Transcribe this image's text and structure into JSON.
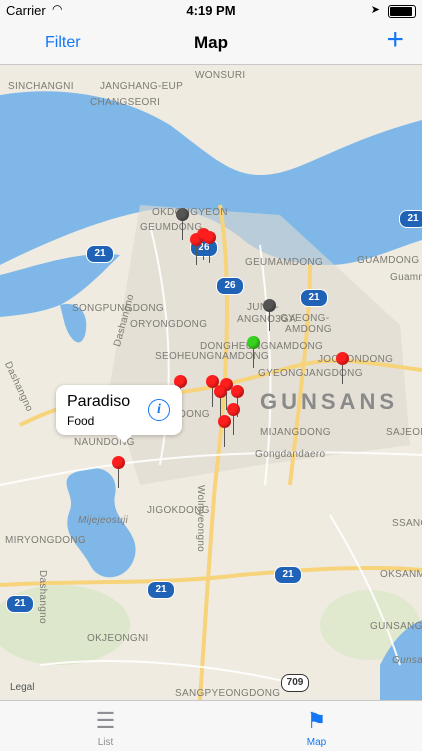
{
  "status_bar": {
    "carrier": "Carrier",
    "time": "4:19 PM"
  },
  "nav": {
    "left_button": "Filter",
    "title": "Map",
    "right_icon": "plus-icon"
  },
  "map": {
    "city_label": "GUNSANS",
    "area_labels": [
      "SINCHANGNI",
      "JANGHANG-EUP",
      "CHANGSEORI",
      "WONSURI",
      "OKDONGYEON",
      "GEUMDONG",
      "GEUMAMDONG",
      "GUAMDONG",
      "Guamnu",
      "SONGPUNGDONG",
      "ORYONGDONG",
      "JUNG-",
      "ANGNO3GA",
      "GYEONG-",
      "AMDONG",
      "DONGHEUNGNAMDONG",
      "SEOHEUNGNAMDONG",
      "JOCHONDONG",
      "GYEONGJANGDONG",
      "SONGDONG",
      "MIJANGDONG",
      "SAJEON",
      "NAUNDONG",
      "Gongdandaero",
      "Wolmyeongno",
      "Mijejeosuji",
      "JIGOKDONG",
      "SSANG",
      "MIRYONGDONG",
      "Dashangno",
      "Dashangno",
      "OKSANM",
      "OKJEONGNI",
      "GUNSANG",
      "SANGPYEONGDONG",
      "Gunsanje",
      "Dashangno"
    ],
    "route_shields": [
      "21",
      "26",
      "26",
      "21",
      "21",
      "21",
      "21",
      "21",
      "21",
      "709"
    ],
    "legal": "Legal",
    "pins": [
      {
        "color": "gray"
      },
      {
        "color": "red"
      },
      {
        "color": "red"
      },
      {
        "color": "red"
      },
      {
        "color": "gray"
      },
      {
        "color": "green"
      },
      {
        "color": "red"
      },
      {
        "color": "red"
      },
      {
        "color": "red"
      },
      {
        "color": "red"
      },
      {
        "color": "red"
      },
      {
        "color": "red"
      },
      {
        "color": "red"
      },
      {
        "color": "red"
      },
      {
        "color": "red"
      }
    ],
    "callout": {
      "name": "Paradiso",
      "category": "Food",
      "icon": "info-icon"
    }
  },
  "tabs": [
    {
      "label": "List",
      "icon": "list-icon",
      "selected": false
    },
    {
      "label": "Map",
      "icon": "map-icon",
      "selected": true
    }
  ],
  "colors": {
    "accent": "#1476f5",
    "pin_red": "#ff1e1e",
    "pin_gray": "#555555",
    "pin_green": "#37d21e",
    "water": "#7fb8e8",
    "shield": "#1f62b6"
  }
}
